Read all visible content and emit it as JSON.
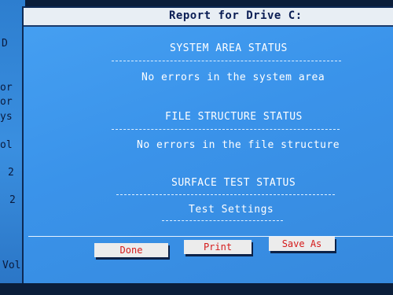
{
  "dialog": {
    "title": "Report for Drive C:",
    "system_area": {
      "heading": "SYSTEM AREA STATUS",
      "message": "No errors in the system area"
    },
    "file_structure": {
      "heading": "FILE STRUCTURE STATUS",
      "message": "No errors in the file structure"
    },
    "surface_test": {
      "heading": "SURFACE TEST STATUS",
      "settings_label": "Test Settings"
    },
    "buttons": {
      "done": "Done",
      "print": "Print",
      "save_as": "Save As"
    }
  },
  "background_window": {
    "fragments": [
      "D",
      "or",
      "or",
      "ys",
      "ol",
      "2",
      "2",
      "Vol"
    ]
  },
  "colors": {
    "dialog_bg": "#3a93ea",
    "title_bg": "#e8eef4",
    "button_text": "#d51a1a"
  }
}
